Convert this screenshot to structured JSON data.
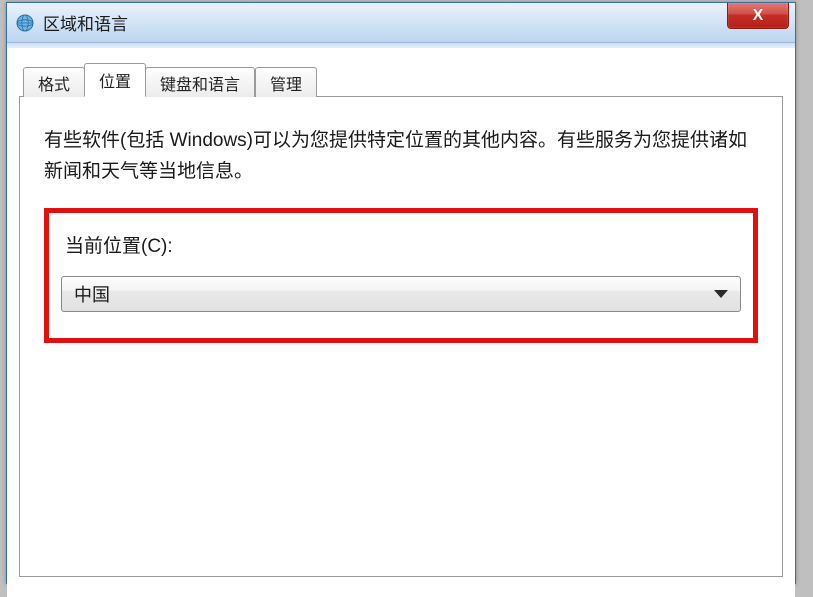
{
  "window": {
    "title": "区域和语言"
  },
  "close_x": "X",
  "tabs": [
    {
      "label": "格式"
    },
    {
      "label": "位置"
    },
    {
      "label": "键盘和语言"
    },
    {
      "label": "管理"
    }
  ],
  "panel": {
    "description": "有些软件(包括 Windows)可以为您提供特定位置的其他内容。有些服务为您提供诸如新闻和天气等当地信息。",
    "current_location_label": "当前位置(C):",
    "current_location_value": "中国"
  }
}
